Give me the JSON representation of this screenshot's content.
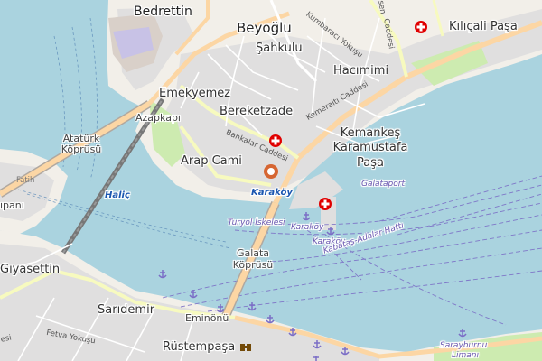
{
  "map": {
    "labels": {
      "bedrettin": "Bedrettin",
      "beyoglu": "Beyoğlu",
      "sahkulu": "Şahkulu",
      "hacimimi": "Hacımimi",
      "kilicali_pasa": "Kılıçali Paşa",
      "emekyemez": "Emekyemez",
      "azapkapi": "Azapkapı",
      "bereketzade": "Bereketzade",
      "ataturk_koprusu": "Atatürk Köprüsü",
      "arap_cami": "Arap Cami",
      "kemankes": "Kemankeş Karamustafa Paşa",
      "karakoy": "Karaköy",
      "galataport": "Galataport",
      "halic": "Haliç",
      "turyol_iskelesi": "Turyol İskelesi",
      "karakoy_pier_1": "Karaköy",
      "karakoy_pier_2": "Karaköy",
      "galata_koprusu": "Galata Köprüsü",
      "kabatas_adalar_hatti": "Kabataş-Adalar Hattı",
      "unkapani": "ıpanı",
      "giyasettin": "Gıyasettin",
      "saridemir": "Sarıdemir",
      "eminonu": "Eminönü",
      "rustempasa": "Rüstempaşa",
      "fetva_yokusu": "Fetva Yokuşu",
      "sarayburnu": "Sarayburnu",
      "limani": "Limanı",
      "esi_left": "esi",
      "fatih": "Fatih",
      "kemeralti": "Kemeraltı Caddesi",
      "bankalar": "Bankalar Caddesi",
      "kumbaraci": "Kumbaracı Yokuşu",
      "hasnun_caddesi": "Caddesi",
      "hasnun": "sen"
    },
    "colors": {
      "water": "#aad3df",
      "land": "#f2efe9",
      "urban": "#e0dfdf",
      "primary_road": "#fcd6a4",
      "secondary_road": "#f7fabf",
      "hospital": "#e00000",
      "ferry": "#7b6ec6",
      "karakoy_marker": "#d66632"
    },
    "icons": {
      "hospital": "hospital-cross-icon",
      "ferry_anchor": "anchor-icon",
      "location": "location-pin-icon",
      "museum": "binoculars-icon"
    }
  }
}
